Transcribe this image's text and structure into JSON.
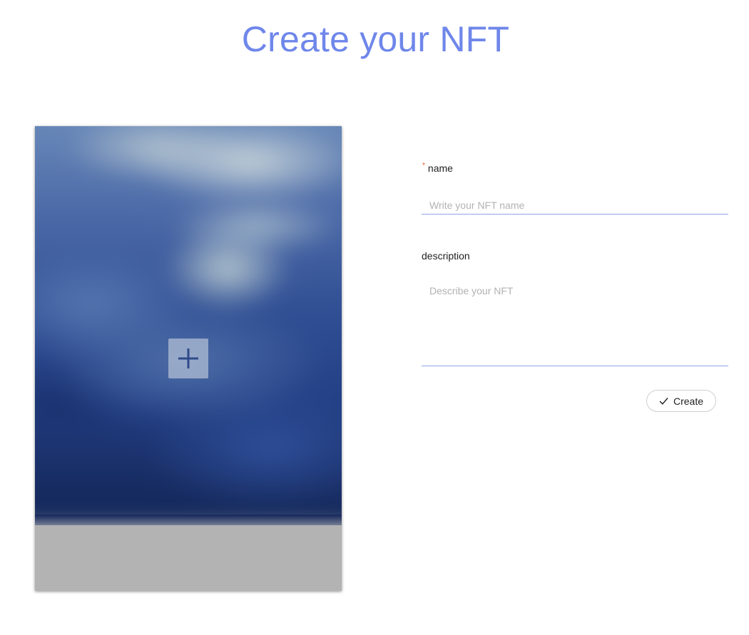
{
  "page": {
    "title": "Create your NFT"
  },
  "image_upload": {
    "add_icon": "plus-icon"
  },
  "form": {
    "name": {
      "required_mark": "*",
      "label": "name",
      "placeholder": "Write your NFT name",
      "value": ""
    },
    "description": {
      "label": "description",
      "placeholder": "Describe your NFT",
      "value": ""
    },
    "submit": {
      "icon": "check-icon",
      "label": "Create"
    }
  },
  "colors": {
    "title": "#6f87ea",
    "input_underline": "#8ea3ec",
    "required": "#e8542b"
  }
}
